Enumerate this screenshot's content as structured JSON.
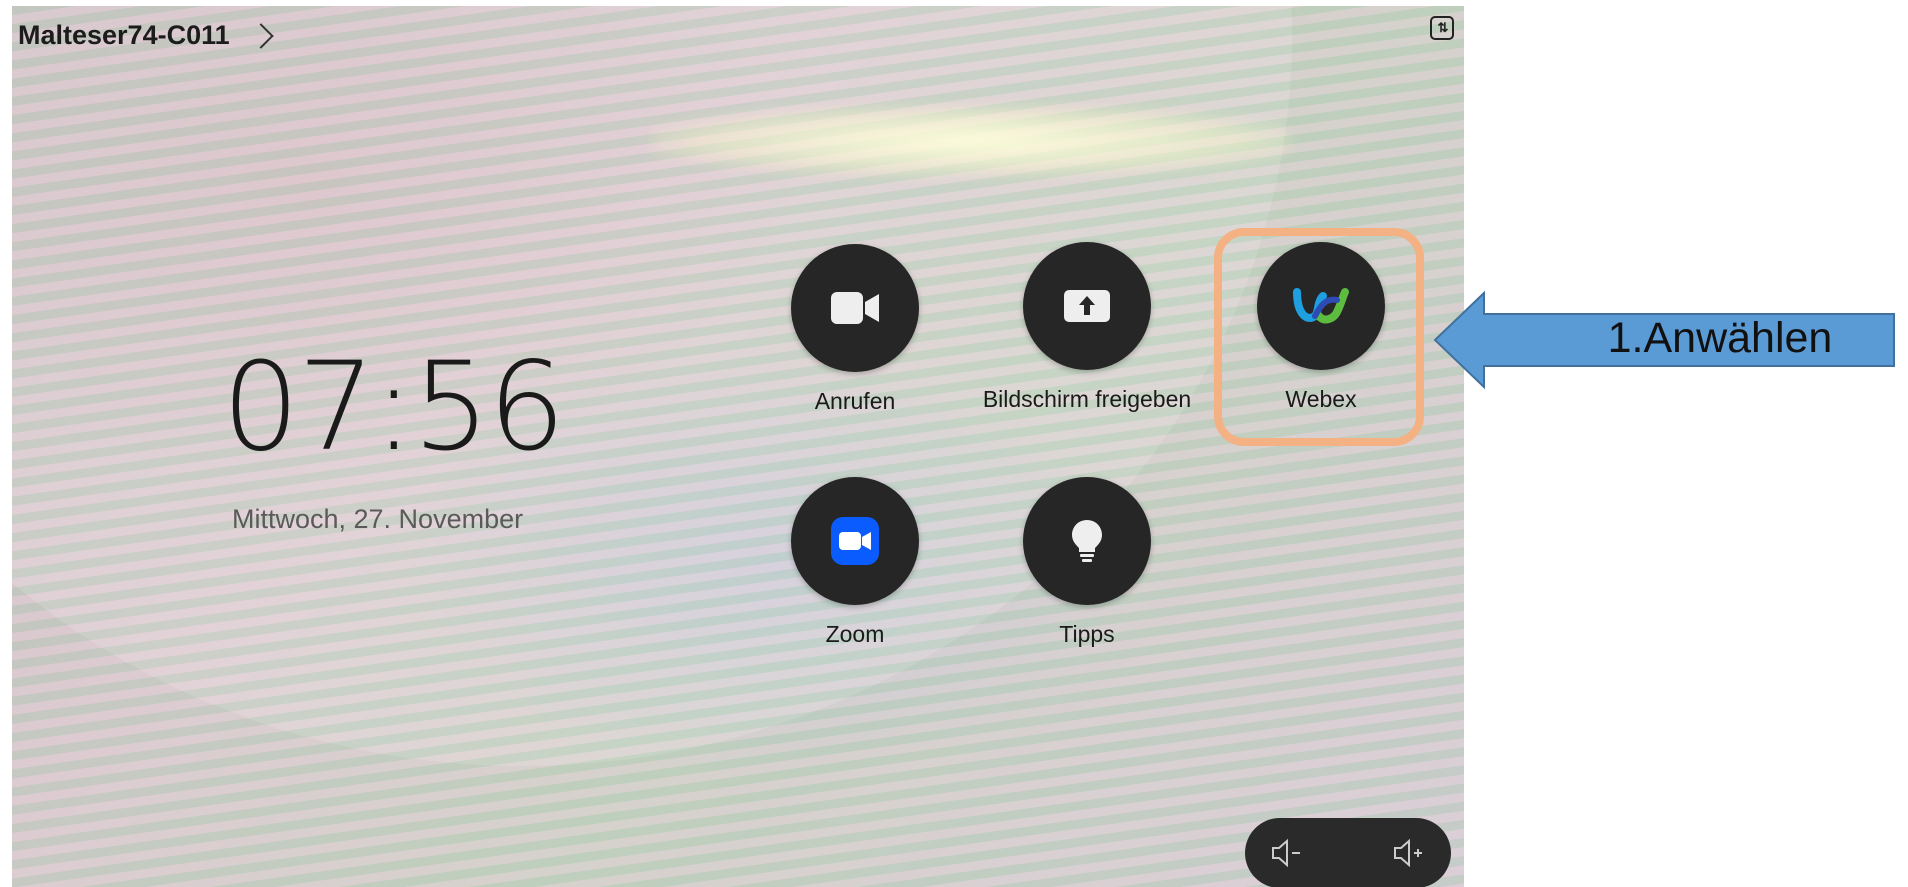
{
  "header": {
    "room_name": "Malteser74-C011"
  },
  "clock": {
    "time": "07:56",
    "date": "Mittwoch, 27. November"
  },
  "tiles": [
    {
      "label": "Anrufen",
      "icon": "video-camera-icon"
    },
    {
      "label": "Bildschirm freigeben",
      "icon": "share-screen-icon"
    },
    {
      "label": "Webex",
      "icon": "webex-logo-icon"
    },
    {
      "label": "Zoom",
      "icon": "zoom-logo-icon"
    },
    {
      "label": "Tipps",
      "icon": "lightbulb-icon"
    }
  ],
  "volume": {
    "down_icon": "volume-down-icon",
    "up_icon": "volume-up-icon"
  },
  "annotation": {
    "text": "1.Anwählen",
    "arrow_color": "#5b9bd5",
    "arrow_border": "#41719c",
    "highlight_color": "#f4b183"
  }
}
